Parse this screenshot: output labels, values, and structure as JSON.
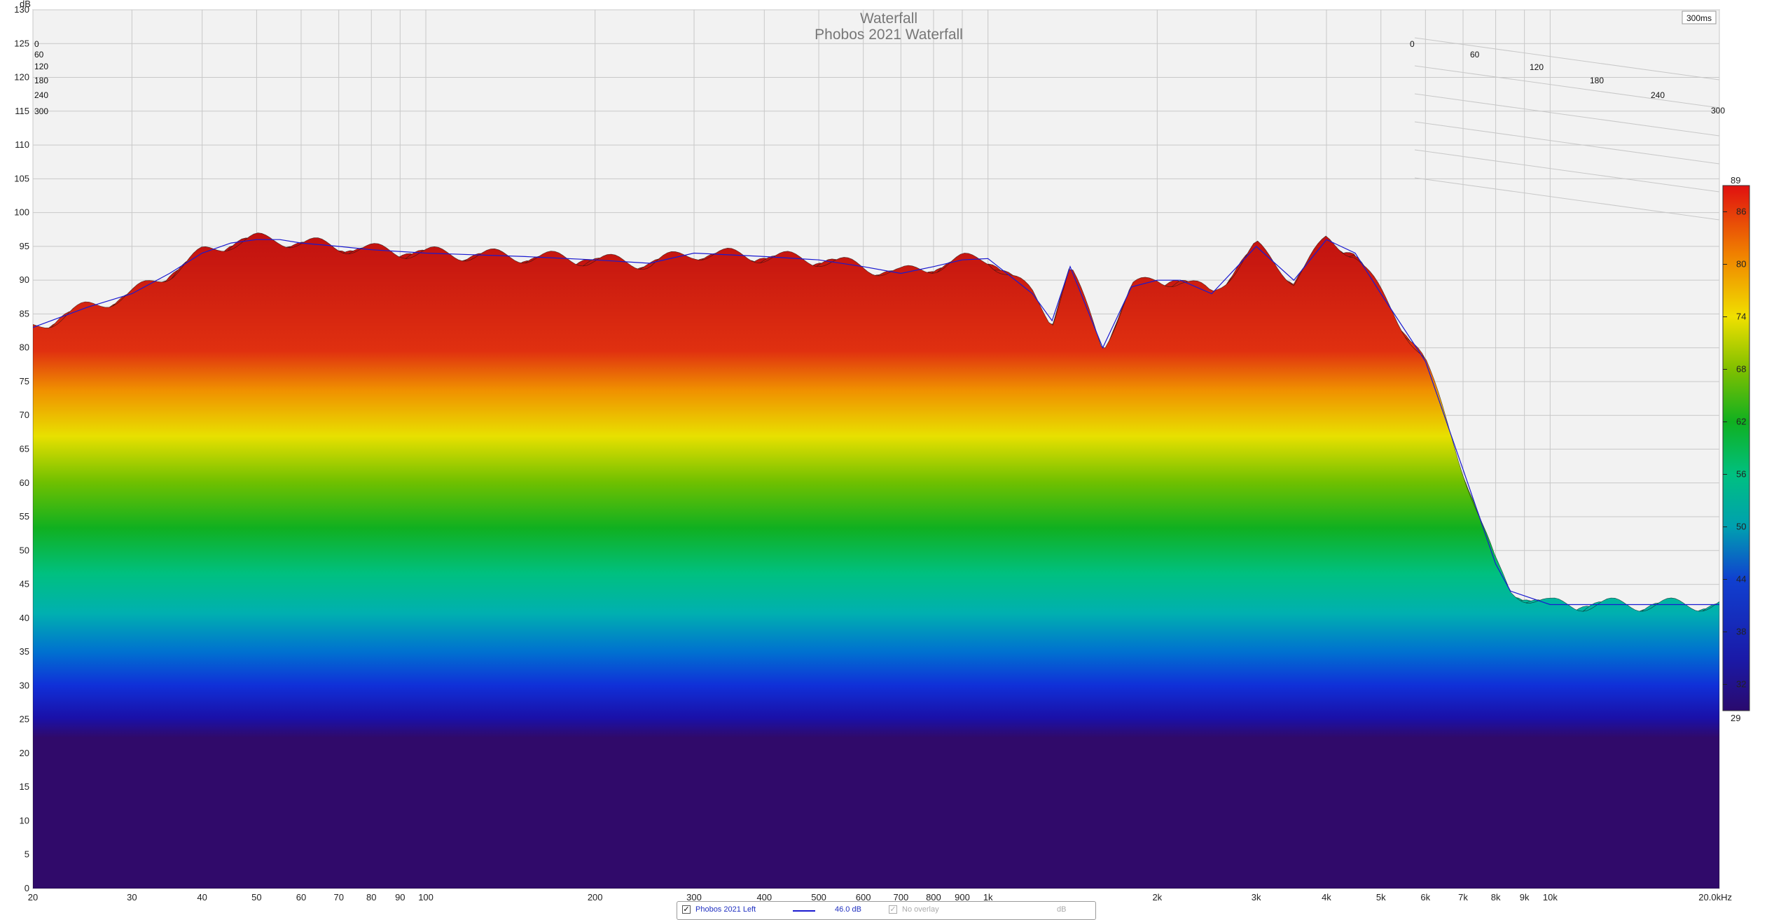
{
  "chart_data": {
    "type": "waterfall",
    "title": "Waterfall",
    "subtitle": "Phobos 2021 Waterfall",
    "time_label": "300ms",
    "y_axis": {
      "unit": "dB",
      "ylim": [
        0,
        130
      ],
      "ticks": [
        "0",
        "5",
        "10",
        "15",
        "20",
        "25",
        "30",
        "35",
        "40",
        "45",
        "50",
        "55",
        "60",
        "65",
        "70",
        "75",
        "80",
        "85",
        "90",
        "95",
        "100",
        "105",
        "110",
        "115",
        "120",
        "125",
        "130"
      ]
    },
    "x_axis": {
      "scale": "log",
      "xlim": [
        20,
        20000
      ],
      "tick_labels": [
        {
          "f": 20,
          "label": "20"
        },
        {
          "f": 30,
          "label": "30"
        },
        {
          "f": 40,
          "label": "40"
        },
        {
          "f": 50,
          "label": "50"
        },
        {
          "f": 60,
          "label": "60"
        },
        {
          "f": 70,
          "label": "70"
        },
        {
          "f": 80,
          "label": "80"
        },
        {
          "f": 90,
          "label": "90"
        },
        {
          "f": 100,
          "label": "100"
        },
        {
          "f": 200,
          "label": "200"
        },
        {
          "f": 300,
          "label": "300"
        },
        {
          "f": 400,
          "label": "400"
        },
        {
          "f": 500,
          "label": "500"
        },
        {
          "f": 600,
          "label": "600"
        },
        {
          "f": 700,
          "label": "700"
        },
        {
          "f": 800,
          "label": "800"
        },
        {
          "f": 900,
          "label": "900"
        },
        {
          "f": 1000,
          "label": "1k"
        },
        {
          "f": 2000,
          "label": "2k"
        },
        {
          "f": 3000,
          "label": "3k"
        },
        {
          "f": 4000,
          "label": "4k"
        },
        {
          "f": 5000,
          "label": "5k"
        },
        {
          "f": 6000,
          "label": "6k"
        },
        {
          "f": 7000,
          "label": "7k"
        },
        {
          "f": 8000,
          "label": "8k"
        },
        {
          "f": 9000,
          "label": "9k"
        },
        {
          "f": 10000,
          "label": "10k"
        },
        {
          "f": 20000,
          "label": "20.0kHz"
        }
      ]
    },
    "time_axis": {
      "unit": "ms",
      "right_labels": [
        "0",
        "60",
        "120",
        "180",
        "240",
        "300"
      ],
      "left_labels": [
        "0",
        "60",
        "120",
        "180",
        "240",
        "300"
      ]
    },
    "colorbar": {
      "min": 29,
      "max": 89,
      "ticks": [
        "32",
        "38",
        "44",
        "50",
        "56",
        "62",
        "68",
        "74",
        "80",
        "86"
      ],
      "top_label": "89",
      "bottom_label": "29",
      "colors": [
        "#2a0a6e",
        "#1a1aa0",
        "#1040d0",
        "#00a0a8",
        "#00c070",
        "#10b020",
        "#80c000",
        "#f0e000",
        "#f08000",
        "#e01010"
      ]
    },
    "series": [
      {
        "name": "Phobos 2021 Left",
        "level": "46.0 dB",
        "front_slice": [
          [
            20,
            83
          ],
          [
            25,
            86
          ],
          [
            30,
            88
          ],
          [
            35,
            91
          ],
          [
            40,
            94
          ],
          [
            45,
            95.5
          ],
          [
            50,
            96
          ],
          [
            55,
            96
          ],
          [
            60,
            95.5
          ],
          [
            70,
            95
          ],
          [
            80,
            94.5
          ],
          [
            100,
            94
          ],
          [
            150,
            93.5
          ],
          [
            200,
            93
          ],
          [
            250,
            92.5
          ],
          [
            300,
            94
          ],
          [
            400,
            93.5
          ],
          [
            500,
            93
          ],
          [
            600,
            92
          ],
          [
            700,
            91
          ],
          [
            800,
            92
          ],
          [
            900,
            93
          ],
          [
            1000,
            93.2
          ],
          [
            1200,
            88
          ],
          [
            1300,
            84
          ],
          [
            1400,
            92
          ],
          [
            1600,
            80
          ],
          [
            1800,
            89
          ],
          [
            2000,
            90
          ],
          [
            2200,
            90
          ],
          [
            2500,
            88
          ],
          [
            3000,
            95
          ],
          [
            3500,
            90
          ],
          [
            4000,
            96
          ],
          [
            4500,
            94
          ],
          [
            5000,
            88
          ],
          [
            6000,
            78
          ],
          [
            7000,
            62
          ],
          [
            8000,
            48
          ],
          [
            8500,
            44
          ],
          [
            10000,
            42
          ],
          [
            20000,
            42
          ]
        ]
      }
    ],
    "legend": {
      "series_label": "Phobos 2021 Left",
      "series_value": "46.0 dB",
      "overlay_label": "No overlay",
      "overlay_unit": "dB"
    }
  }
}
